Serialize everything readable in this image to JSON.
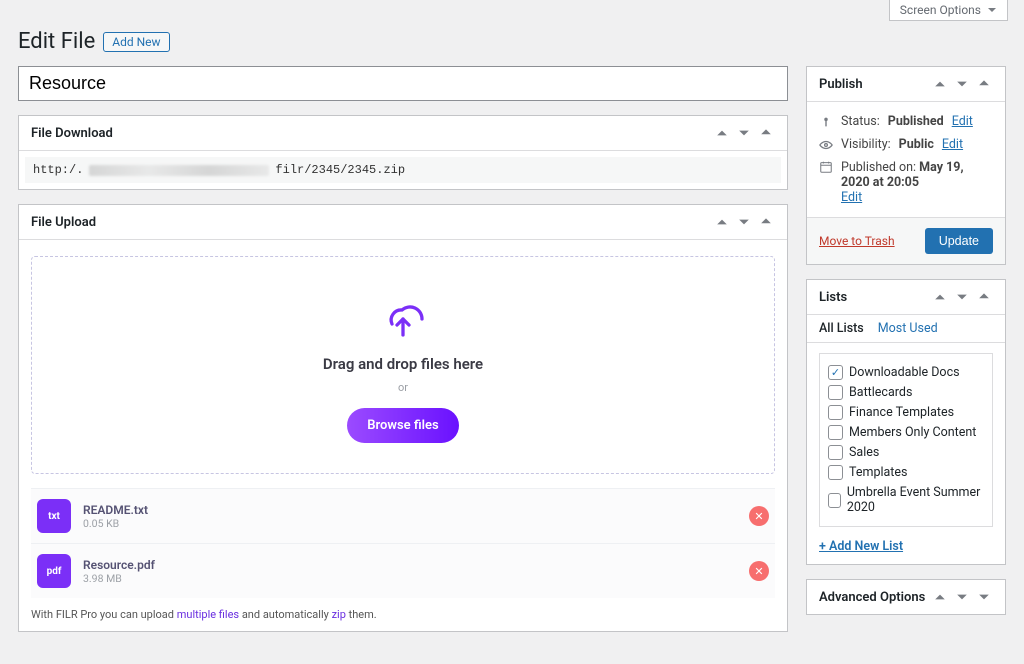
{
  "top": {
    "screen_options": "Screen Options"
  },
  "heading": {
    "title": "Edit File",
    "add_new": "Add New"
  },
  "title_value": "Resource",
  "download": {
    "title": "File Download",
    "prefix": "http:/.",
    "suffix": "filr/2345/2345.zip"
  },
  "upload": {
    "title": "File Upload",
    "drop_text": "Drag and drop files here",
    "or": "or",
    "browse": "Browse files",
    "files": [
      {
        "badge": "txt",
        "name": "README.txt",
        "size": "0.05 KB"
      },
      {
        "badge": "pdf",
        "name": "Resource.pdf",
        "size": "3.98 MB"
      }
    ],
    "note_pre": "With FILR Pro you can upload ",
    "note_link1": "multiple files",
    "note_mid": " and automatically ",
    "note_link2": "zip",
    "note_post": " them."
  },
  "publish": {
    "title": "Publish",
    "status_label": "Status:",
    "status_value": "Published",
    "status_edit": "Edit",
    "visibility_label": "Visibility:",
    "visibility_value": "Public",
    "visibility_edit": "Edit",
    "published_label": "Published on:",
    "published_value": "May 19, 2020 at 20:05",
    "published_edit": "Edit",
    "trash": "Move to Trash",
    "update": "Update"
  },
  "lists": {
    "title": "Lists",
    "tabs": {
      "all": "All Lists",
      "most": "Most Used"
    },
    "items": [
      {
        "label": "Downloadable Docs",
        "checked": true
      },
      {
        "label": "Battlecards",
        "checked": false
      },
      {
        "label": "Finance Templates",
        "checked": false
      },
      {
        "label": "Members Only Content",
        "checked": false
      },
      {
        "label": "Sales",
        "checked": false
      },
      {
        "label": "Templates",
        "checked": false
      },
      {
        "label": "Umbrella Event Summer 2020",
        "checked": false
      }
    ],
    "add_new": "+ Add New List"
  },
  "advanced": {
    "title": "Advanced Options"
  }
}
